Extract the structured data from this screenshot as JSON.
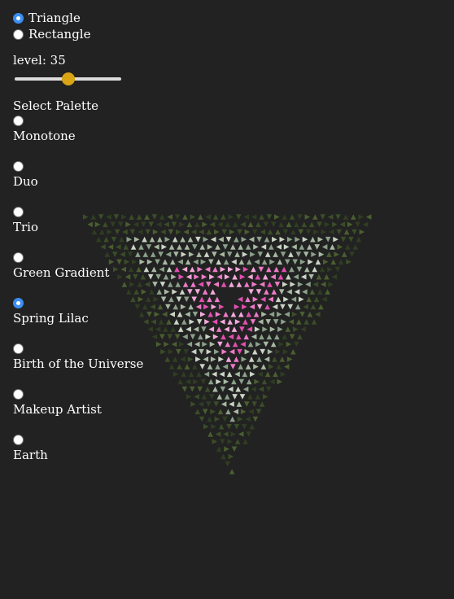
{
  "shapes": [
    {
      "label": "Triangle",
      "checked": true
    },
    {
      "label": "Rectangle",
      "checked": false
    }
  ],
  "level": {
    "label": "level: 35",
    "value": 35,
    "fraction": 0.5
  },
  "palette": {
    "title": "Select Palette",
    "options": [
      {
        "label": "Monotone",
        "checked": false
      },
      {
        "label": "Duo",
        "checked": false
      },
      {
        "label": "Trio",
        "checked": false
      },
      {
        "label": "Green Gradient",
        "checked": false
      },
      {
        "label": "Spring Lilac",
        "checked": true
      },
      {
        "label": "Birth of the Universe",
        "checked": false
      },
      {
        "label": "Makeup Artist",
        "checked": false
      },
      {
        "label": "Earth",
        "checked": false
      }
    ]
  },
  "colors": {
    "background": "#222222",
    "accent": "#3b8ef2",
    "slider_thumb": "#d9a514",
    "outer_band": [
      "#2f3d22",
      "#3a4d28",
      "#4a5e30"
    ],
    "middle_band": [
      "#8aa08a",
      "#a7b8a2",
      "#c9d4c4"
    ],
    "inner_band": [
      "#e24fb0",
      "#ee7ac7",
      "#f4a9da"
    ]
  }
}
